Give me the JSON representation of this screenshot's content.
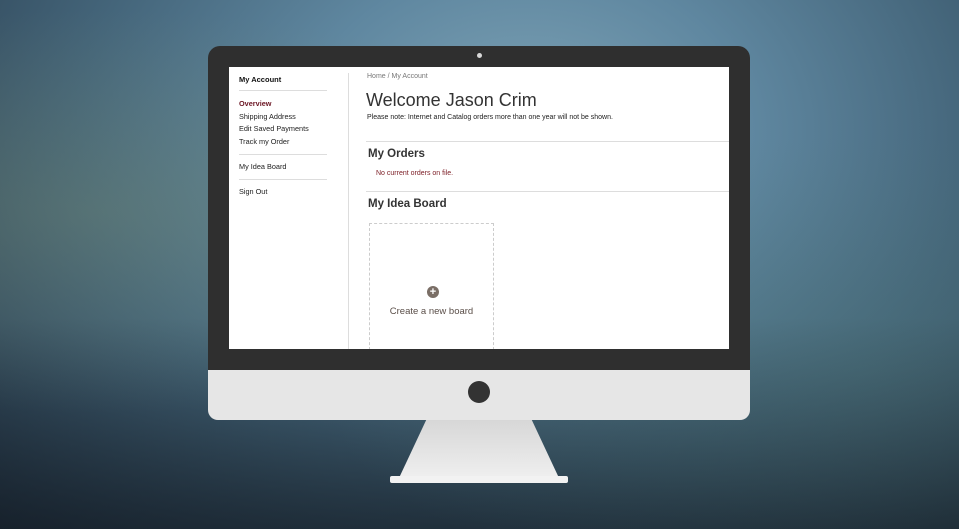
{
  "sidebar": {
    "heading": "My Account",
    "items": [
      {
        "label": "Overview",
        "active": true
      },
      {
        "label": "Shipping Address"
      },
      {
        "label": "Edit Saved Payments"
      },
      {
        "label": "Track my Order"
      },
      {
        "label": "My Idea Board"
      },
      {
        "label": "Sign Out"
      }
    ]
  },
  "main": {
    "breadcrumb": "Home / My Account",
    "welcome": "Welcome Jason Crim",
    "note": "Please note: Internet and Catalog orders more than one year will not be shown.",
    "orders": {
      "title": "My Orders",
      "empty_text": "No current orders on file."
    },
    "idea_board": {
      "title": "My Idea Board",
      "create_label": "Create a new board",
      "create_icon": "plus-circle-icon"
    }
  },
  "colors": {
    "accent": "#6b1523",
    "card_icon": "#7a6e66"
  }
}
